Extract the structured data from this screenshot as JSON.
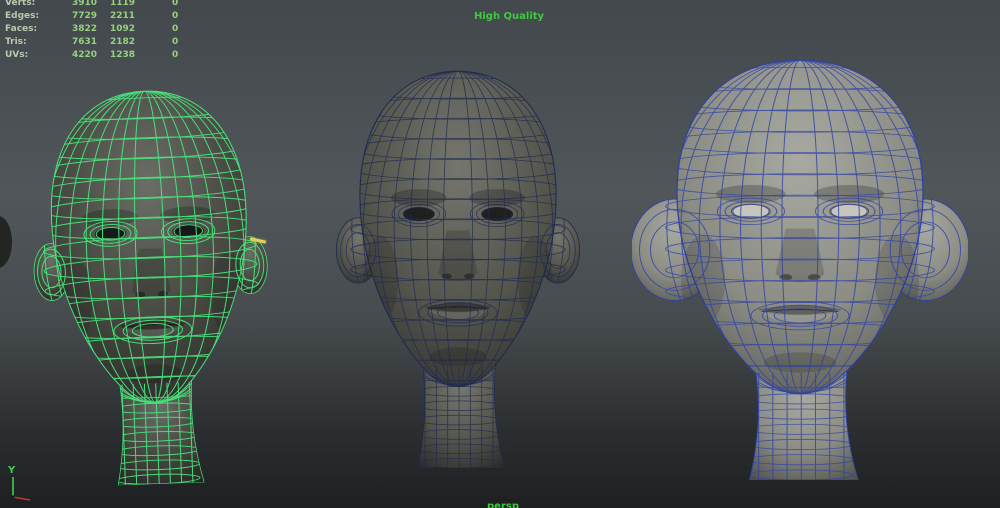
{
  "hud": {
    "rows": [
      {
        "label": "Verts:",
        "col1": "3910",
        "col2": "1119",
        "col3": "0"
      },
      {
        "label": "Edges:",
        "col1": "7729",
        "col2": "2211",
        "col3": "0"
      },
      {
        "label": "Faces:",
        "col1": "3822",
        "col2": "1092",
        "col3": "0"
      },
      {
        "label": "Tris:",
        "col1": "7631",
        "col2": "2182",
        "col3": "0"
      },
      {
        "label": "UVs:",
        "col1": "4220",
        "col2": "1238",
        "col3": "0"
      }
    ]
  },
  "viewport": {
    "quality_label": "High Quality",
    "camera_label": "persp",
    "axis": {
      "y_label": "Y"
    },
    "colors": {
      "hud_label": "#b9c9ae",
      "hud_value": "#96d17e",
      "overlay_green": "#3ecb3e",
      "axis_y": "#3bd14b",
      "axis_x": "#c03a2c",
      "selection_yellow": "#e3cf52"
    },
    "heads": [
      {
        "name": "head-model-left-selected",
        "selected": true,
        "wireframe_color": "#49e57d",
        "skin_light": "#6b6e66",
        "skin_mid": "#44463f",
        "skin_dark": "#232422",
        "eye_color": "#17181a"
      },
      {
        "name": "head-model-center",
        "selected": false,
        "wireframe_color": "#1e2a52",
        "skin_light": "#75766d",
        "skin_mid": "#53544c",
        "skin_dark": "#2a2b28",
        "eye_color": "#1f201e"
      },
      {
        "name": "head-model-right",
        "selected": false,
        "wireframe_color": "#2f42a6",
        "skin_light": "#a8a9a1",
        "skin_mid": "#8b8c84",
        "skin_dark": "#4f504a",
        "eye_color": "#c6c6bf"
      }
    ]
  }
}
